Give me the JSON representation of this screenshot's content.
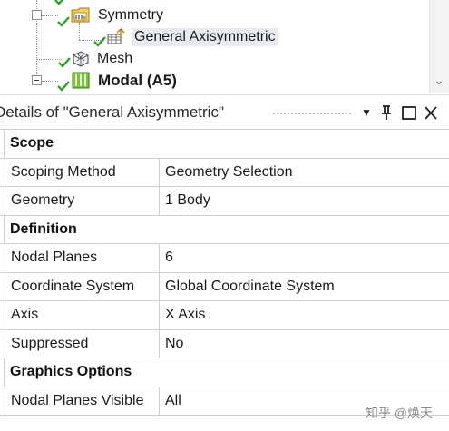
{
  "tree": {
    "nodes": [
      {
        "label": "Symmetry",
        "bold": false,
        "selected": false
      },
      {
        "label": "General Axisymmetric",
        "bold": false,
        "selected": true
      },
      {
        "label": "Mesh",
        "bold": false,
        "selected": false
      },
      {
        "label": "Modal (A5)",
        "bold": true,
        "selected": false
      }
    ]
  },
  "details": {
    "title": "Details of \"General Axisymmetric\"",
    "buttons": {
      "dropdown": "▼",
      "pin": "Ⅰ",
      "maximize": "□",
      "close": "✕"
    },
    "sections": [
      {
        "label": "Scope",
        "rows": [
          {
            "name": "Scoping Method",
            "value": "Geometry Selection"
          },
          {
            "name": "Geometry",
            "value": "1 Body"
          }
        ]
      },
      {
        "label": "Definition",
        "rows": [
          {
            "name": "Nodal Planes",
            "value": "6"
          },
          {
            "name": "Coordinate System",
            "value": "Global Coordinate System"
          },
          {
            "name": "Axis",
            "value": "X Axis"
          },
          {
            "name": "Suppressed",
            "value": "No"
          }
        ]
      },
      {
        "label": "Graphics Options",
        "rows": [
          {
            "name": "Nodal Planes Visible",
            "value": "All"
          }
        ]
      }
    ]
  },
  "watermark": "知乎 @焕天",
  "colors": {
    "check_green": "#2f9e2f",
    "folder_yellow": "#e8b838",
    "modal_green": "#7cc23a",
    "grid_line": "#cfcfcf"
  }
}
